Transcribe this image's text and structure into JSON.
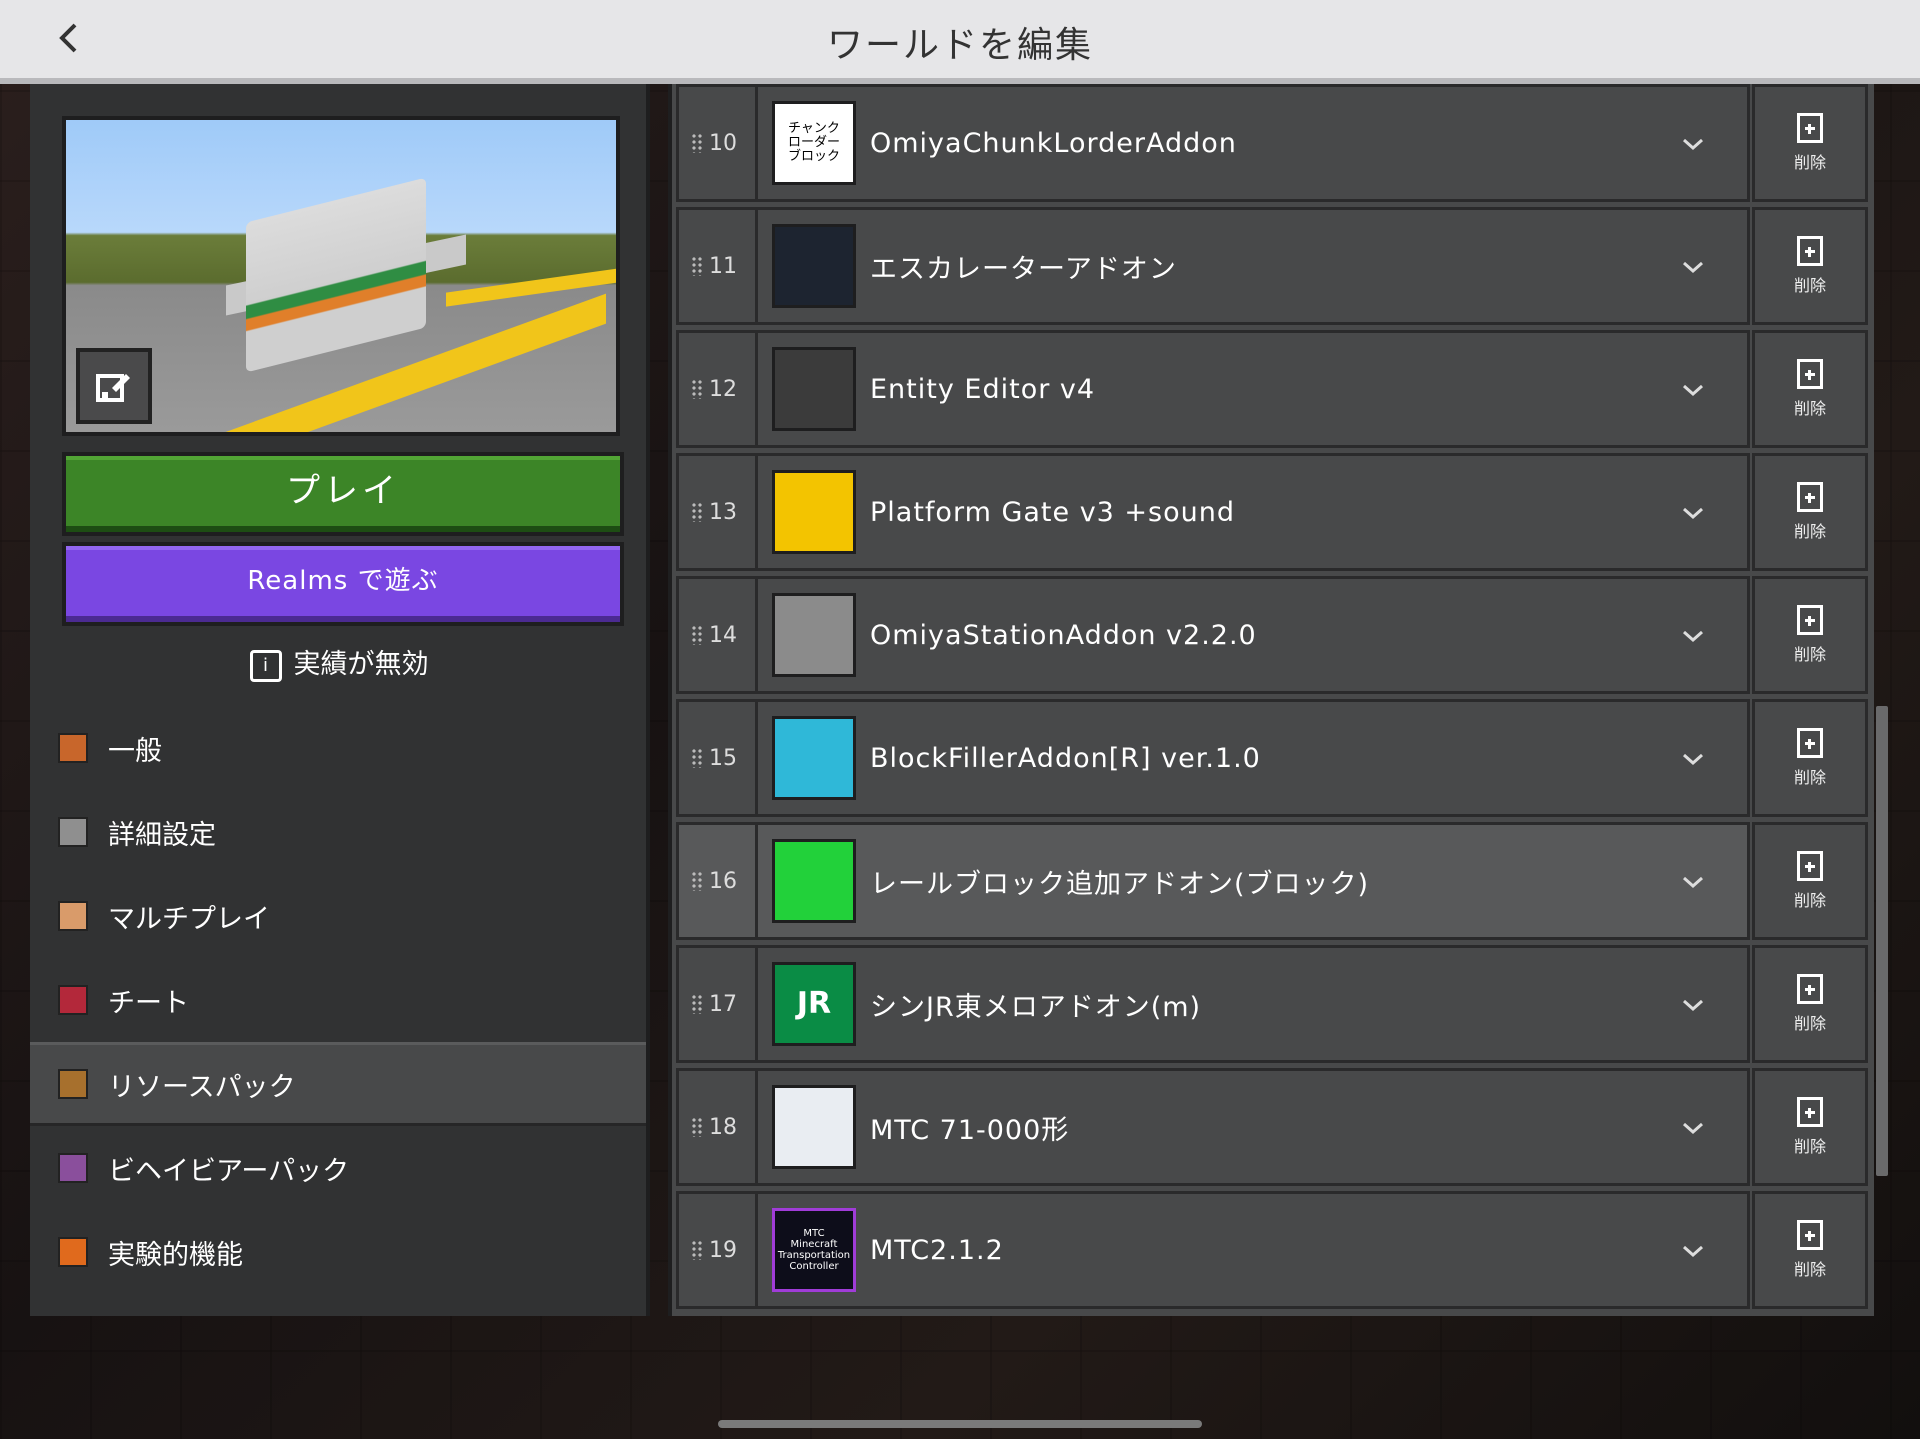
{
  "header": {
    "title": "ワールドを編集",
    "back_icon": "chevron-left-icon"
  },
  "left": {
    "play_label": "プレイ",
    "realms_label": "Realms で遊ぶ",
    "achievements_label": "実績が無効",
    "nav": [
      {
        "label": "一般",
        "icon": "gear-icon",
        "color": "#c8662b",
        "active": false
      },
      {
        "label": "詳細設定",
        "icon": "furnace-icon",
        "color": "#8f8f8f",
        "active": false
      },
      {
        "label": "マルチプレイ",
        "icon": "players-icon",
        "color": "#d99b6a",
        "active": false
      },
      {
        "label": "チート",
        "icon": "command-block-icon",
        "color": "#b3283a",
        "active": false
      },
      {
        "label": "リソースパック",
        "icon": "chest-icon",
        "color": "#a7702d",
        "active": true
      },
      {
        "label": "ビヘイビアーパック",
        "icon": "behavior-icon",
        "color": "#8a4f9c",
        "active": false
      },
      {
        "label": "実験的機能",
        "icon": "experiment-icon",
        "color": "#e06a1d",
        "active": false
      }
    ]
  },
  "packs": [
    {
      "num": "10",
      "name": "OmiyaChunkLorderAddon",
      "icon_text": "チャンク\nローダー\nブロック",
      "icon_bg": "#ffffff"
    },
    {
      "num": "11",
      "name": "エスカレーターアドオン",
      "icon_text": "",
      "icon_bg": "#1d2430"
    },
    {
      "num": "12",
      "name": "Entity Editor v4",
      "icon_text": "",
      "icon_bg": "#3b3b3b"
    },
    {
      "num": "13",
      "name": "Platform Gate v3 +sound",
      "icon_text": "",
      "icon_bg": "#f3c400"
    },
    {
      "num": "14",
      "name": "OmiyaStationAddon v2.2.0",
      "icon_text": "",
      "icon_bg": "#8b8b8b"
    },
    {
      "num": "15",
      "name": "BlockFillerAddon[R] ver.1.0",
      "icon_text": "",
      "icon_bg": "#2fb8d8"
    },
    {
      "num": "16",
      "name": "レールブロック追加アドオン(ブロック)",
      "icon_text": "",
      "icon_bg": "#22d13a",
      "highlight": true
    },
    {
      "num": "17",
      "name": "シンJR東メロアドオン(m)",
      "icon_text": "JR",
      "icon_bg": "#0a8c45"
    },
    {
      "num": "18",
      "name": "MTC 71-000形",
      "icon_text": "",
      "icon_bg": "#e9edf2"
    },
    {
      "num": "19",
      "name": "MTC2.1.2",
      "icon_text": "MTC\nMinecraft\nTransportation\nController",
      "icon_bg": "#0d0d1a"
    }
  ],
  "delete_label": "削除",
  "chevron_icon": "chevron-down-icon"
}
